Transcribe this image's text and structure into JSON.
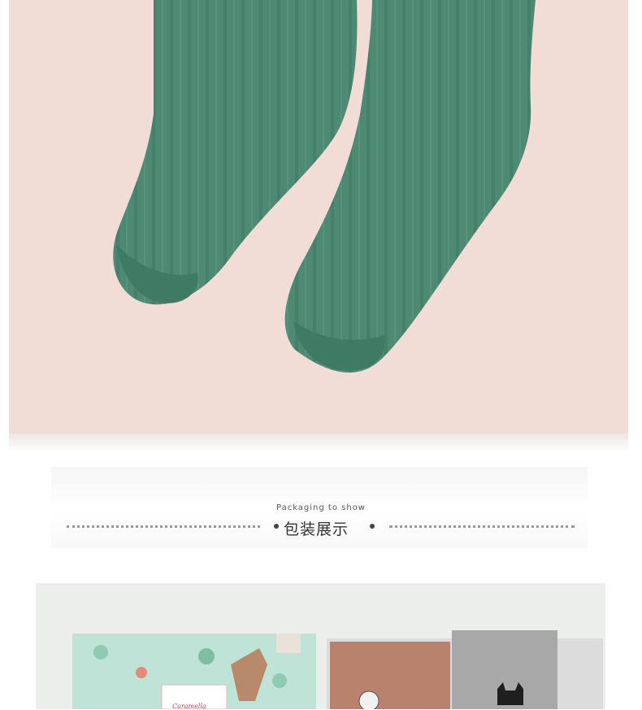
{
  "hero": {
    "image": "green-ribbed-socks-photo",
    "background_color": "#f2ddd6",
    "sock_color": "#4e8a73"
  },
  "section": {
    "subtitle_en": "Packaging to show",
    "title_cn": "包装展示"
  },
  "packaging_photo": {
    "image": "gift-box-photo",
    "brand_label": "Caramella"
  }
}
